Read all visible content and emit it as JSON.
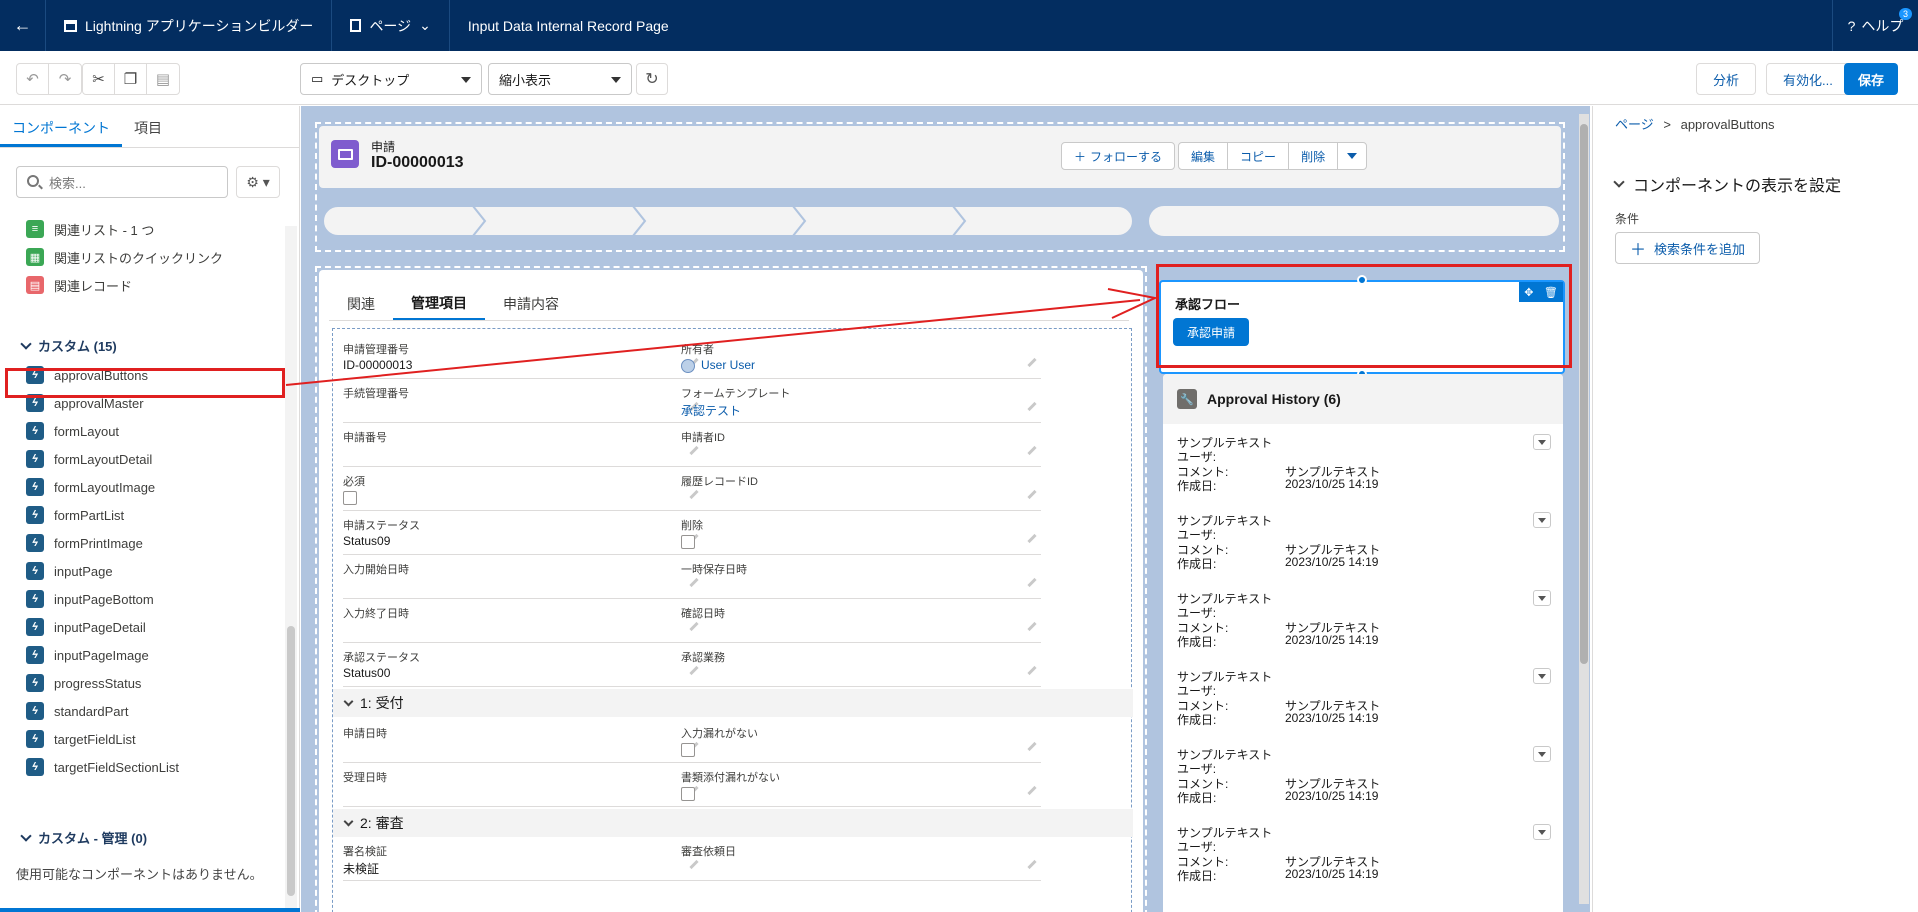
{
  "topbar": {
    "app_name": "Lightning アプリケーションビルダー",
    "page_menu": "ページ",
    "page_name": "Input Data Internal Record Page",
    "help_label": "ヘルプ",
    "help_badge": "3"
  },
  "toolbar": {
    "device_select": "デスクトップ",
    "zoom_select": "縮小表示",
    "analyze_label": "分析",
    "activate_label": "有効化...",
    "save_label": "保存"
  },
  "left": {
    "tabs": [
      "コンポーネント",
      "項目"
    ],
    "search_placeholder": "検索...",
    "standard_items": [
      {
        "label": "関連リスト - 1 つ",
        "color": "#3ba755"
      },
      {
        "label": "関連リストのクイックリンク",
        "color": "#3ba755"
      },
      {
        "label": "関連レコード",
        "color": "#e8676b"
      }
    ],
    "custom_header": "カスタム (15)",
    "custom_items": [
      "approvalButtons",
      "approvalMaster",
      "formLayout",
      "formLayoutDetail",
      "formLayoutImage",
      "formPartList",
      "formPrintImage",
      "inputPage",
      "inputPageBottom",
      "inputPageDetail",
      "inputPageImage",
      "progressStatus",
      "standardPart",
      "targetFieldList",
      "targetFieldSectionList"
    ],
    "managed_header": "カスタム - 管理 (0)",
    "managed_empty": "使用可能なコンポーネントはありません。"
  },
  "record": {
    "type_label": "申請",
    "record_id": "ID-00000013",
    "follow_label": "フォローする",
    "actions": [
      "編集",
      "コピー",
      "削除"
    ]
  },
  "detail": {
    "tabs": [
      "関連",
      "管理項目",
      "申請内容"
    ],
    "fields_top": [
      {
        "label": "申請管理番号",
        "value": "ID-00000013"
      },
      {
        "label": "所有者",
        "value": "User User",
        "link": true
      },
      {
        "label": "手続管理番号",
        "value": ""
      },
      {
        "label": "フォームテンプレート",
        "value": "承認テスト",
        "link": true
      },
      {
        "label": "申請番号",
        "value": ""
      },
      {
        "label": "申請者ID",
        "value": ""
      },
      {
        "label": "必須",
        "value": "",
        "checkbox": true
      },
      {
        "label": "履歴レコードID",
        "value": ""
      },
      {
        "label": "申請ステータス",
        "value": "Status09"
      },
      {
        "label": "削除",
        "value": "",
        "checkbox": true
      },
      {
        "label": "入力開始日時",
        "value": ""
      },
      {
        "label": "一時保存日時",
        "value": ""
      },
      {
        "label": "入力終了日時",
        "value": ""
      },
      {
        "label": "確認日時",
        "value": ""
      },
      {
        "label": "承認ステータス",
        "value": "Status00"
      },
      {
        "label": "承認業務",
        "value": ""
      }
    ],
    "section1": "1: 受付",
    "fields_s1": [
      {
        "label": "申請日時",
        "value": ""
      },
      {
        "label": "入力漏れがない",
        "value": "",
        "checkbox": true
      },
      {
        "label": "受理日時",
        "value": ""
      },
      {
        "label": "書類添付漏れがない",
        "value": "",
        "checkbox": true
      }
    ],
    "section2": "2: 審査",
    "fields_s2": [
      {
        "label": "署名検証",
        "value": "未検証"
      },
      {
        "label": "審査依頼日",
        "value": ""
      }
    ]
  },
  "approval": {
    "title": "承認フロー",
    "button": "承認申請"
  },
  "history": {
    "title": "Approval History (6)",
    "items": [
      {
        "name": "サンプルテキスト",
        "user_label": "ユーザ:",
        "comment_label": "コメント:",
        "comment": "サンプルテキスト",
        "date_label": "作成日:",
        "date": "2023/10/25 14:19"
      },
      {
        "name": "サンプルテキスト",
        "user_label": "ユーザ:",
        "comment_label": "コメント:",
        "comment": "サンプルテキスト",
        "date_label": "作成日:",
        "date": "2023/10/25 14:19"
      },
      {
        "name": "サンプルテキスト",
        "user_label": "ユーザ:",
        "comment_label": "コメント:",
        "comment": "サンプルテキスト",
        "date_label": "作成日:",
        "date": "2023/10/25 14:19"
      },
      {
        "name": "サンプルテキスト",
        "user_label": "ユーザ:",
        "comment_label": "コメント:",
        "comment": "サンプルテキスト",
        "date_label": "作成日:",
        "date": "2023/10/25 14:19"
      },
      {
        "name": "サンプルテキスト",
        "user_label": "ユーザ:",
        "comment_label": "コメント:",
        "comment": "サンプルテキスト",
        "date_label": "作成日:",
        "date": "2023/10/25 14:19"
      },
      {
        "name": "サンプルテキスト",
        "user_label": "ユーザ:",
        "comment_label": "コメント:",
        "comment": "サンプルテキスト",
        "date_label": "作成日:",
        "date": "2023/10/25 14:19"
      }
    ]
  },
  "right": {
    "crumb_root": "ページ",
    "crumb_sep": ">",
    "crumb_current": "approvalButtons",
    "section_title": "コンポーネントの表示を設定",
    "condition_label": "条件",
    "add_condition": "検索条件を追加"
  },
  "colors": {
    "nav": "#032d60",
    "brand": "#0176d3",
    "annotation": "#e02020",
    "canvas": "#b0c4df"
  }
}
